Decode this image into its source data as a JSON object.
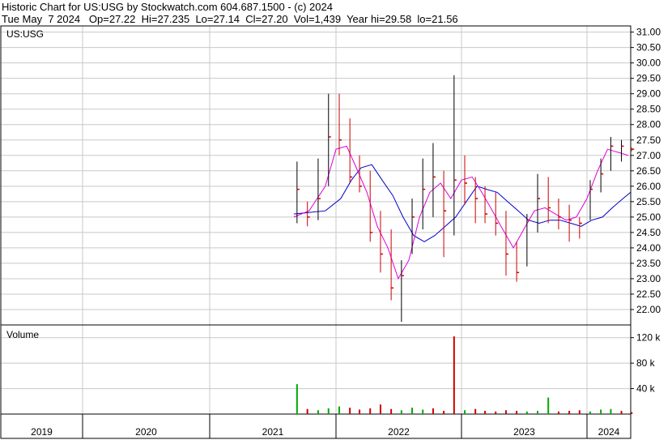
{
  "header": {
    "line1": "Historic Chart for US:USG by Stockwatch.com 604.687.1500 - (c) 2024",
    "line2": "Tue May  7 2024   Op=27.22  Hi=27.235  Lo=27.14  Cl=27.20  Vol=1,439  Year hi=29.58  lo=21.56"
  },
  "price_panel": {
    "label": "US:USG"
  },
  "volume_panel": {
    "label": "Volume"
  },
  "colors": {
    "up_bar": "#000000",
    "down_bar": "#cc0000",
    "ma_short": "#dd00dd",
    "ma_long": "#0000cc",
    "vol_up": "#00aa00",
    "vol_down": "#cc0000",
    "grid": "#c8c8c8"
  },
  "chart_data": [
    {
      "type": "line",
      "title": "Historic Chart for US:USG",
      "ylim": [
        21.5,
        31.2
      ],
      "yticks": [
        "22.00",
        "22.50",
        "23.00",
        "23.50",
        "24.00",
        "24.50",
        "25.00",
        "25.50",
        "26.00",
        "26.50",
        "27.00",
        "27.50",
        "28.00",
        "28.50",
        "29.00",
        "29.50",
        "30.00",
        "30.50",
        "31.00"
      ],
      "x_labels": [
        "2019",
        "2020",
        "2021",
        "2022",
        "2023",
        "2024"
      ],
      "x_range": [
        "2019-01-01",
        "2024-05-07"
      ],
      "series": [
        {
          "kind": "ohlc",
          "x": [
            "2021-09-01",
            "2021-10-01",
            "2021-11-01",
            "2021-12-01",
            "2022-01-01",
            "2022-02-01",
            "2022-03-01",
            "2022-04-01",
            "2022-05-01",
            "2022-06-01",
            "2022-07-01",
            "2022-08-01",
            "2022-09-01",
            "2022-10-01",
            "2022-11-01",
            "2022-12-01",
            "2023-01-01",
            "2023-02-01",
            "2023-03-01",
            "2023-04-01",
            "2023-05-01",
            "2023-06-01",
            "2023-07-01",
            "2023-08-01",
            "2023-09-01",
            "2023-10-01",
            "2023-11-01",
            "2023-12-01",
            "2024-01-01",
            "2024-02-01",
            "2024-03-01",
            "2024-04-01",
            "2024-05-01"
          ],
          "high": [
            26.8,
            25.5,
            26.9,
            29.0,
            29.0,
            28.2,
            27.0,
            26.5,
            25.2,
            24.6,
            23.6,
            25.6,
            26.9,
            27.4,
            26.5,
            29.6,
            27.0,
            26.3,
            26.0,
            25.8,
            25.2,
            24.2,
            25.1,
            26.4,
            26.3,
            25.6,
            25.4,
            25.0,
            26.2,
            26.9,
            27.6,
            27.5,
            27.25
          ],
          "low": [
            24.8,
            24.7,
            24.9,
            26.0,
            27.0,
            26.1,
            25.8,
            24.2,
            23.2,
            22.3,
            21.6,
            23.8,
            24.6,
            25.0,
            23.7,
            24.4,
            25.4,
            24.8,
            24.8,
            24.4,
            23.1,
            22.9,
            23.4,
            24.5,
            24.8,
            24.6,
            24.2,
            24.3,
            24.9,
            25.8,
            26.5,
            26.8,
            27.14
          ],
          "close": [
            25.9,
            25.0,
            25.6,
            27.6,
            27.5,
            26.3,
            26.0,
            24.5,
            23.8,
            22.7,
            23.1,
            25.0,
            25.9,
            26.3,
            25.2,
            26.2,
            26.1,
            25.6,
            25.1,
            24.8,
            23.8,
            23.2,
            24.9,
            25.6,
            25.3,
            25.0,
            24.9,
            24.8,
            25.9,
            26.4,
            27.3,
            27.3,
            27.2
          ]
        },
        {
          "name": "",
          "kind": "ma_short",
          "x": [
            "2021-09-01",
            "2021-10-15",
            "2021-12-01",
            "2022-01-01",
            "2022-02-01",
            "2022-03-01",
            "2022-04-01",
            "2022-05-01",
            "2022-06-01",
            "2022-07-01",
            "2022-08-01",
            "2022-09-01",
            "2022-10-01",
            "2022-11-01",
            "2022-12-01",
            "2023-01-01",
            "2023-02-01",
            "2023-03-01",
            "2023-04-01",
            "2023-05-01",
            "2023-06-01",
            "2023-07-01",
            "2023-08-01",
            "2023-09-01",
            "2023-10-01",
            "2023-11-01",
            "2023-12-01",
            "2024-01-01",
            "2024-02-01",
            "2024-03-01",
            "2024-04-01",
            "2024-05-01"
          ],
          "values": [
            25.0,
            25.2,
            26.0,
            27.2,
            27.3,
            26.6,
            25.8,
            24.7,
            24.0,
            23.0,
            23.6,
            25.0,
            25.8,
            26.1,
            25.6,
            26.2,
            26.3,
            25.8,
            25.2,
            24.6,
            24.0,
            24.6,
            25.2,
            25.3,
            25.1,
            24.9,
            25.0,
            25.6,
            26.5,
            27.2,
            27.1,
            27.0
          ]
        },
        {
          "name": "",
          "kind": "ma_long",
          "x": [
            "2021-09-01",
            "2021-12-01",
            "2022-01-15",
            "2022-02-15",
            "2022-03-15",
            "2022-04-15",
            "2022-05-15",
            "2022-06-15",
            "2022-07-15",
            "2022-08-15",
            "2022-09-15",
            "2022-10-15",
            "2022-11-15",
            "2022-12-15",
            "2023-01-15",
            "2023-02-15",
            "2023-03-15",
            "2023-04-15",
            "2023-05-15",
            "2023-06-15",
            "2023-07-15",
            "2023-08-15",
            "2023-09-15",
            "2023-10-15",
            "2023-11-15",
            "2023-12-15",
            "2024-01-15",
            "2024-02-15",
            "2024-03-15",
            "2024-04-15",
            "2024-05-07"
          ],
          "values": [
            25.1,
            25.2,
            25.6,
            26.2,
            26.6,
            26.7,
            26.2,
            25.7,
            25.0,
            24.4,
            24.2,
            24.4,
            24.7,
            25.0,
            25.5,
            26.0,
            25.9,
            25.8,
            25.5,
            25.2,
            24.9,
            24.8,
            24.9,
            24.9,
            24.8,
            24.7,
            24.9,
            25.0,
            25.3,
            25.6,
            25.8
          ]
        }
      ]
    },
    {
      "type": "bar",
      "title": "Volume",
      "ylim": [
        0,
        140000
      ],
      "yticks": [
        "40 k",
        "80 k",
        "120 k"
      ],
      "x": [
        "2021-09-01",
        "2021-10-01",
        "2021-11-01",
        "2021-12-01",
        "2022-01-01",
        "2022-02-01",
        "2022-03-01",
        "2022-04-01",
        "2022-05-01",
        "2022-06-01",
        "2022-07-01",
        "2022-08-01",
        "2022-09-01",
        "2022-10-01",
        "2022-11-01",
        "2022-12-01",
        "2023-01-01",
        "2023-02-01",
        "2023-03-01",
        "2023-04-01",
        "2023-05-01",
        "2023-06-01",
        "2023-07-01",
        "2023-08-01",
        "2023-09-01",
        "2023-10-01",
        "2023-11-01",
        "2023-12-01",
        "2024-01-01",
        "2024-02-01",
        "2024-03-01",
        "2024-04-01",
        "2024-05-01"
      ],
      "values": [
        47000,
        8000,
        6000,
        9000,
        12000,
        10000,
        7000,
        9000,
        15000,
        8000,
        6000,
        10000,
        7000,
        9000,
        5000,
        122000,
        6000,
        8000,
        5000,
        4000,
        6000,
        5000,
        4000,
        5000,
        26000,
        4000,
        5000,
        6000,
        4000,
        7000,
        8000,
        5000,
        3000
      ],
      "up": [
        true,
        false,
        true,
        true,
        true,
        false,
        false,
        false,
        false,
        false,
        true,
        true,
        true,
        false,
        false,
        false,
        true,
        false,
        false,
        false,
        false,
        false,
        true,
        true,
        true,
        false,
        false,
        false,
        true,
        true,
        true,
        false,
        false
      ]
    }
  ]
}
